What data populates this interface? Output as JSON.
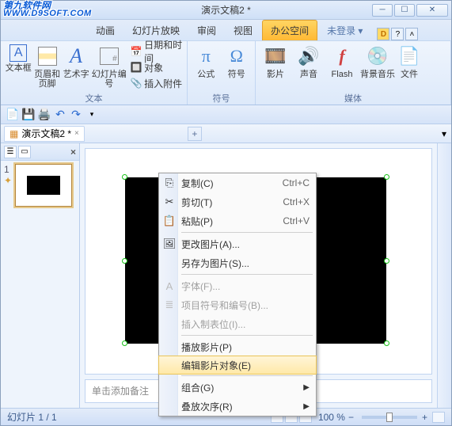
{
  "title": "演示文稿2 *",
  "watermark": {
    "line1": "第九软件网",
    "line2": "WWW.D9SOFT.COM"
  },
  "tabs": {
    "animation": "动画",
    "slideshow": "幻灯片放映",
    "review": "审阅",
    "view": "视图",
    "office": "办公空间",
    "login": "未登录 ▾"
  },
  "ribbon": {
    "textbox": "文本框",
    "header_footer": "页眉和页脚",
    "wordart": "艺术字",
    "slide_number": "幻灯片编号",
    "date_time": "日期和时间",
    "object": "对象",
    "insert_attachment": "插入附件",
    "formula": "公式",
    "symbol": "符号",
    "movie": "影片",
    "sound": "声音",
    "flash": "Flash",
    "bg_music": "背景音乐",
    "file": "文件",
    "group_text": "文本",
    "group_symbol": "符号",
    "group_media": "媒体"
  },
  "doc_tab": "演示文稿2 *",
  "thumb_num": "1",
  "notes_placeholder": "单击添加备注",
  "status": {
    "slide": "幻灯片 1 / 1",
    "zoom": "100 %"
  },
  "ctx": {
    "copy": "复制(C)",
    "copy_sc": "Ctrl+C",
    "cut": "剪切(T)",
    "cut_sc": "Ctrl+X",
    "paste": "粘贴(P)",
    "paste_sc": "Ctrl+V",
    "change_pic": "更改图片(A)...",
    "save_as_pic": "另存为图片(S)...",
    "font": "字体(F)...",
    "bullets": "项目符号和编号(B)...",
    "tab_stop": "插入制表位(I)...",
    "play_movie": "播放影片(P)",
    "edit_movie": "编辑影片对象(E)",
    "group": "组合(G)",
    "order": "叠放次序(R)"
  }
}
